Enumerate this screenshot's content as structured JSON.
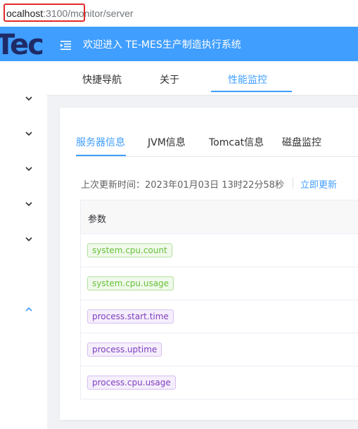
{
  "browser": {
    "url_host": "ocalhost",
    "url_port": ":3100/",
    "url_path": "monitor/server"
  },
  "header": {
    "logo_text": "Tec",
    "welcome": "欢迎进入 TE-MES生产制造执行系统"
  },
  "tags": [
    {
      "label": "快捷导航"
    },
    {
      "label": "关于"
    },
    {
      "label": "性能监控"
    }
  ],
  "subtabs": [
    {
      "label": "服务器信息"
    },
    {
      "label": "JVM信息"
    },
    {
      "label": "Tomcat信息"
    },
    {
      "label": "磁盘监控"
    }
  ],
  "update": {
    "label": "上次更新时间：2023年01月03日 13时22分58秒",
    "refresh_link": "立即更新"
  },
  "table": {
    "header": "参数",
    "rows": [
      {
        "param": "system.cpu.count",
        "tag": "green"
      },
      {
        "param": "system.cpu.usage",
        "tag": "green"
      },
      {
        "param": "process.start.time",
        "tag": "purple"
      },
      {
        "param": "process.uptime",
        "tag": "purple"
      },
      {
        "param": "process.cpu.usage",
        "tag": "purple"
      }
    ]
  },
  "colors": {
    "primary": "#409eff",
    "header_bg": "#409eff",
    "logo": "#1f2b66",
    "tag_green": "#67c23a",
    "tag_purple": "#7e3ebd",
    "url_highlight": "#e02a2a"
  }
}
